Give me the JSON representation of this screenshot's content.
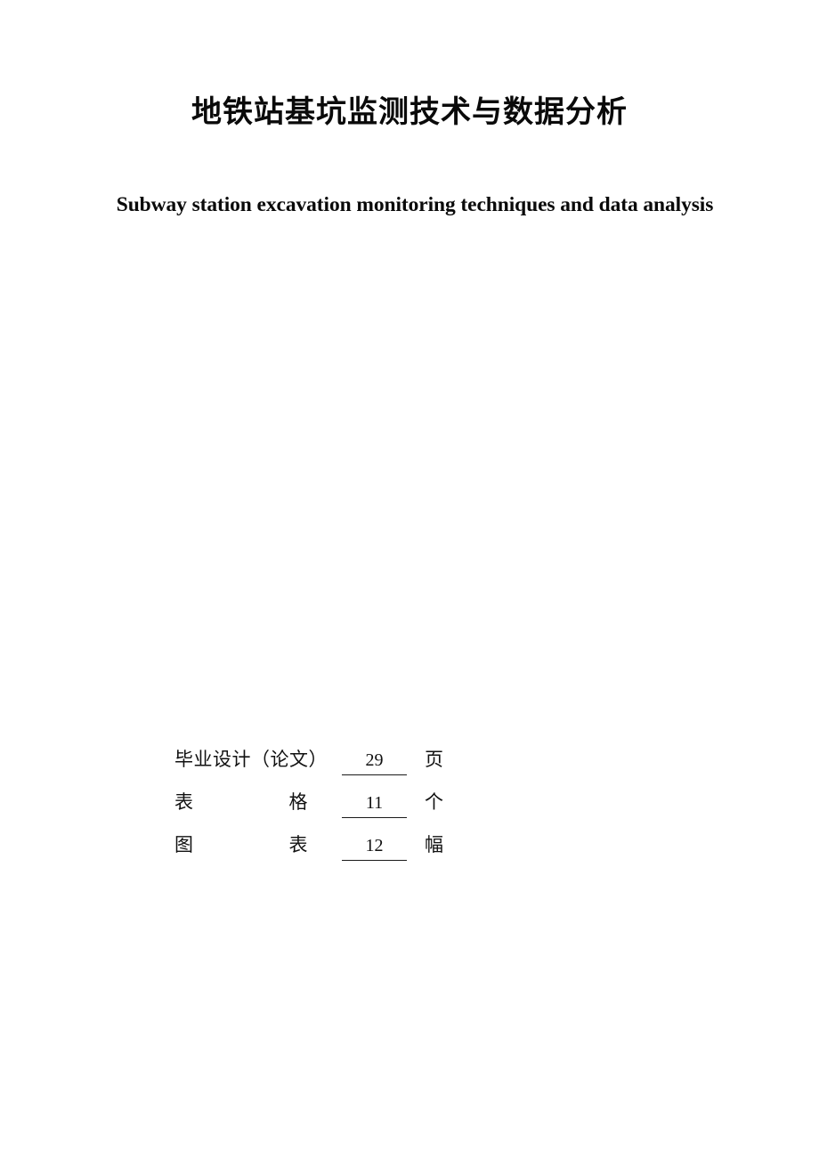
{
  "document": {
    "title_cn": "地铁站基坑监测技术与数据分析",
    "title_en": "Subway station excavation monitoring techniques and data analysis"
  },
  "stats_form": {
    "rows": [
      {
        "label": "毕业设计（论文）",
        "label_style": "solid",
        "value": "29",
        "unit": "页"
      },
      {
        "label_char_1": "表",
        "label_char_2": "格",
        "label_style": "spread",
        "value": "11",
        "unit": "个"
      },
      {
        "label_char_1": "图",
        "label_char_2": "表",
        "label_style": "spread",
        "value": "12",
        "unit": "幅"
      }
    ]
  }
}
